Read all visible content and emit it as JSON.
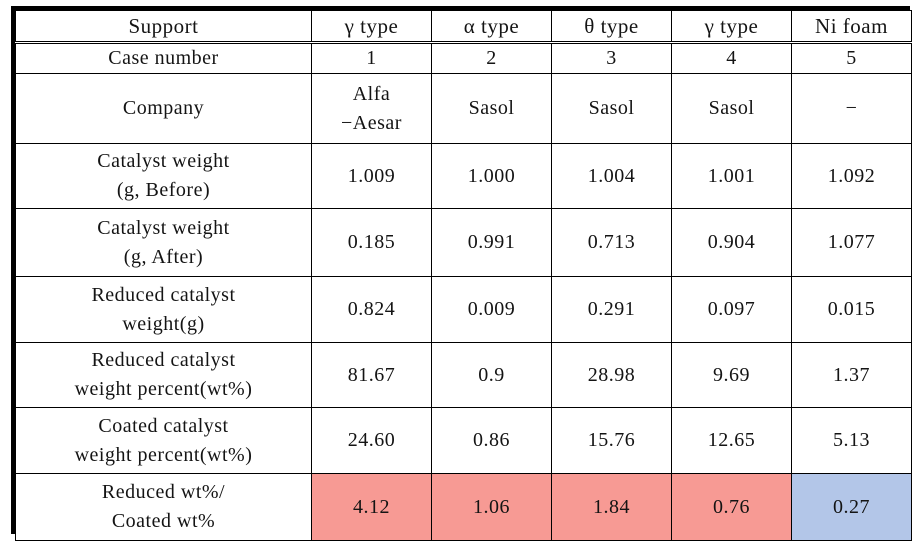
{
  "table": {
    "columns": [
      "Support",
      "γ type",
      "α type",
      "θ type",
      "γ type",
      "Ni foam"
    ],
    "header": {
      "label": "Support",
      "c1": "γ type",
      "c2": "α type",
      "c3": "θ type",
      "c4": "γ type",
      "c5": "Ni foam"
    },
    "rows": [
      {
        "label": "Case number",
        "label_line1": "Case number",
        "label_line2": "",
        "values": [
          "1",
          "2",
          "3",
          "4",
          "5"
        ]
      },
      {
        "label": "Company",
        "label_line1": "Company",
        "label_line2": "",
        "values": [
          "Alfa\n−Aesar",
          "Sasol",
          "Sasol",
          "Sasol",
          "−"
        ],
        "v1_line1": "Alfa",
        "v1_line2": "−Aesar",
        "v2": "Sasol",
        "v3": "Sasol",
        "v4": "Sasol",
        "v5": "−"
      },
      {
        "label": "Catalyst weight (g, Before)",
        "label_line1": "Catalyst weight",
        "label_line2": "(g, Before)",
        "values": [
          "1.009",
          "1.000",
          "1.004",
          "1.001",
          "1.092"
        ]
      },
      {
        "label": "Catalyst weight (g, After)",
        "label_line1": "Catalyst weight",
        "label_line2": "(g, After)",
        "values": [
          "0.185",
          "0.991",
          "0.713",
          "0.904",
          "1.077"
        ]
      },
      {
        "label": "Reduced catalyst weight(g)",
        "label_line1": "Reduced catalyst",
        "label_line2": "weight(g)",
        "values": [
          "0.824",
          "0.009",
          "0.291",
          "0.097",
          "0.015"
        ]
      },
      {
        "label": "Reduced catalyst weight percent(wt%)",
        "label_line1": "Reduced catalyst",
        "label_line2": "weight percent(wt%)",
        "values": [
          "81.67",
          "0.9",
          "28.98",
          "9.69",
          "1.37"
        ]
      },
      {
        "label": "Coated catalyst weight percent(wt%)",
        "label_line1": "Coated catalyst",
        "label_line2": "weight percent(wt%)",
        "values": [
          "24.60",
          "0.86",
          "15.76",
          "12.65",
          "5.13"
        ]
      },
      {
        "label": "Reduced wt%/ Coated wt%",
        "label_line1": "Reduced wt%/",
        "label_line2": "Coated wt%",
        "values": [
          "4.12",
          "1.06",
          "1.84",
          "0.76",
          "0.27"
        ]
      }
    ],
    "highlight_colors": {
      "pink": "#F79A94",
      "blue": "#B3C6E8"
    }
  }
}
